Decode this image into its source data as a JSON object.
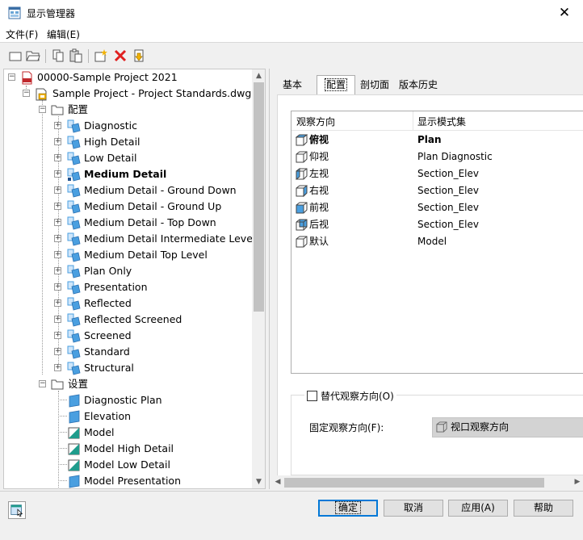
{
  "window": {
    "title": "显示管理器",
    "close_glyph": "✕"
  },
  "menu": [
    {
      "label": "文件(F)"
    },
    {
      "label": "编辑(E)"
    }
  ],
  "toolbar": {
    "buttons": [
      {
        "name": "new-file-icon"
      },
      {
        "name": "open-folder-icon"
      },
      {
        "name": "copy-icon"
      },
      {
        "name": "paste-icon"
      },
      {
        "name": "new-item-icon"
      },
      {
        "name": "delete-icon"
      },
      {
        "name": "purge-icon"
      }
    ]
  },
  "tree": {
    "project": "00000-Sample Project 2021",
    "drawing": "Sample Project - Project Standards.dwg",
    "config_folder": "配置",
    "configurations": [
      {
        "label": "Diagnostic"
      },
      {
        "label": "High Detail"
      },
      {
        "label": "Low Detail"
      },
      {
        "label": "Medium Detail",
        "bold": true
      },
      {
        "label": "Medium Detail - Ground Down"
      },
      {
        "label": "Medium Detail - Ground Up"
      },
      {
        "label": "Medium Detail - Top Down"
      },
      {
        "label": "Medium Detail Intermediate Level"
      },
      {
        "label": "Medium Detail Top Level"
      },
      {
        "label": "Plan Only"
      },
      {
        "label": "Presentation"
      },
      {
        "label": "Reflected"
      },
      {
        "label": "Reflected Screened"
      },
      {
        "label": "Screened"
      },
      {
        "label": "Standard"
      },
      {
        "label": "Structural"
      }
    ],
    "sets_folder": "设置",
    "sets": [
      {
        "label": "Diagnostic Plan",
        "icon": "plan"
      },
      {
        "label": "Elevation",
        "icon": "plan"
      },
      {
        "label": "Model",
        "icon": "model"
      },
      {
        "label": "Model High Detail",
        "icon": "model"
      },
      {
        "label": "Model Low Detail",
        "icon": "model"
      },
      {
        "label": "Model Presentation",
        "icon": "plan"
      }
    ]
  },
  "tabs": [
    {
      "label": "基本"
    },
    {
      "label": "配置",
      "active": true
    },
    {
      "label": "剖切面"
    },
    {
      "label": "版本历史"
    }
  ],
  "config_table": {
    "col_direction": "观察方向",
    "col_set": "显示模式集",
    "rows": [
      {
        "direction": "俯视",
        "set": "Plan",
        "bold": true
      },
      {
        "direction": "仰视",
        "set": "Plan Diagnostic"
      },
      {
        "direction": "左视",
        "set": "Section_Elev"
      },
      {
        "direction": "右视",
        "set": "Section_Elev"
      },
      {
        "direction": "前视",
        "set": "Section_Elev"
      },
      {
        "direction": "后视",
        "set": "Section_Elev"
      },
      {
        "direction": "默认",
        "set": "Model"
      }
    ]
  },
  "override": {
    "checkbox_label": "替代观察方向(O)",
    "checked": false,
    "fixed_label": "固定观察方向(F):",
    "fixed_value": "视口观察方向"
  },
  "buttons": {
    "ok": "确定",
    "cancel": "取消",
    "apply": "应用(A)",
    "help": "帮助"
  },
  "colors": {
    "accent": "#0078d7",
    "icon_blue": "#4a9fe0",
    "icon_teal": "#1f9c8c"
  }
}
